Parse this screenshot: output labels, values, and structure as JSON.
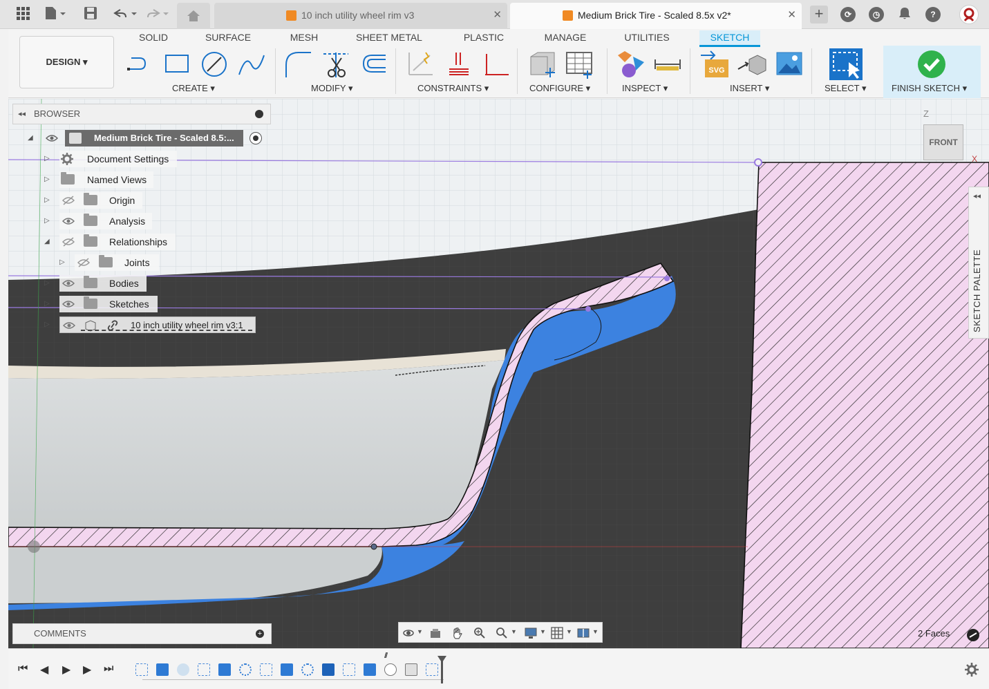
{
  "tabs": [
    {
      "label": "10 inch utility wheel rim v3",
      "active": false
    },
    {
      "label": "Medium Brick Tire - Scaled 8.5x v2*",
      "active": true
    }
  ],
  "toolbar": {
    "workspace_button": "DESIGN",
    "workspace_tabs": [
      "SOLID",
      "SURFACE",
      "MESH",
      "SHEET METAL",
      "PLASTIC",
      "MANAGE",
      "UTILITIES",
      "SKETCH"
    ],
    "active_tab": "SKETCH",
    "groups": {
      "create": "CREATE",
      "modify": "MODIFY",
      "constraints": "CONSTRAINTS",
      "configure": "CONFIGURE",
      "inspect": "INSPECT",
      "insert": "INSERT",
      "select": "SELECT",
      "finish": "FINISH SKETCH"
    }
  },
  "browser": {
    "title": "BROWSER",
    "root": "Medium Brick Tire - Scaled 8.5:...",
    "items": [
      {
        "label": "Document Settings",
        "icon": "gear-icon"
      },
      {
        "label": "Named Views",
        "icon": "folder-icon"
      },
      {
        "label": "Origin",
        "icon": "folder-icon",
        "visible": false
      },
      {
        "label": "Analysis",
        "icon": "folder-icon",
        "visible": true
      },
      {
        "label": "Relationships",
        "icon": "folder-icon",
        "visible": false
      },
      {
        "label": "Joints",
        "icon": "folder-icon",
        "visible": false
      },
      {
        "label": "Bodies",
        "icon": "folder-icon",
        "visible": true
      },
      {
        "label": "Sketches",
        "icon": "folder-icon",
        "visible": true
      },
      {
        "label": "10 inch utility wheel rim v3:1",
        "icon": "component-link-icon",
        "visible": true
      }
    ]
  },
  "comments": {
    "title": "COMMENTS"
  },
  "sketch_palette": {
    "label": "SKETCH PALETTE"
  },
  "viewcube": {
    "face": "FRONT",
    "axis_z": "Z",
    "axis_x": "X"
  },
  "status": {
    "selection": "2 Faces"
  },
  "colors": {
    "accent": "#0696d7",
    "finish_green": "#2fb24c",
    "profile_fill": "#f3d6ef",
    "face_blue": "#3c82e0",
    "model_dark": "#3c3c3c",
    "constraint_purple": "#9a7ae0"
  }
}
